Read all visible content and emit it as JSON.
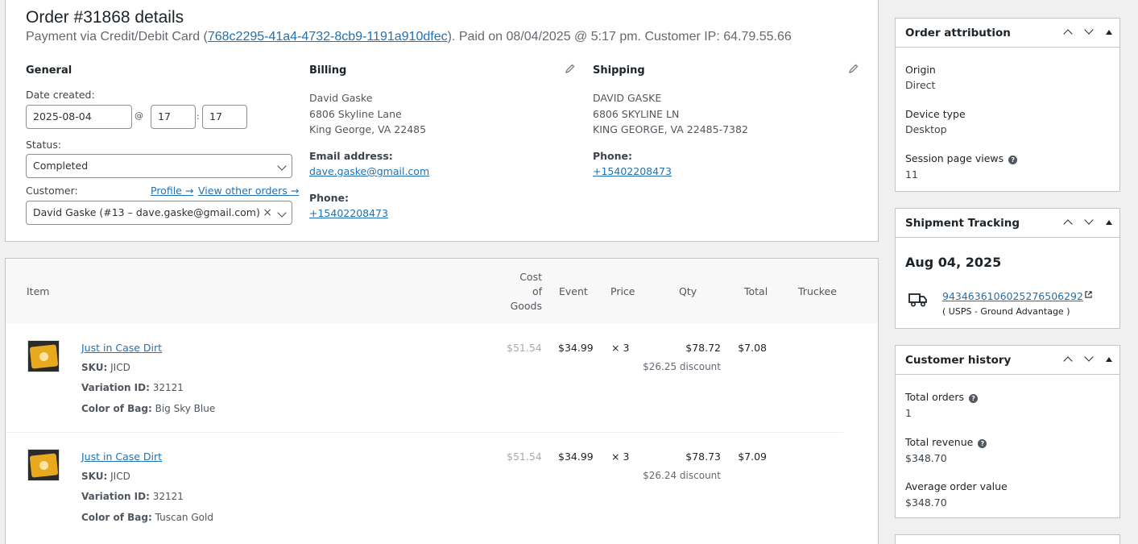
{
  "order": {
    "title": "Order #31868 details",
    "payment_prefix": "Payment via Credit/Debit Card (",
    "transaction_id": "768c2295-41a4-4732-8cb9-1191a910dfec",
    "payment_suffix": "). Paid on 08/04/2025 @ 5:17 pm. Customer IP: 64.79.55.66"
  },
  "general": {
    "heading": "General",
    "date_label": "Date created:",
    "date": "2025-08-04",
    "at": "@",
    "hour": "17",
    "colon": ":",
    "minute": "17",
    "status_label": "Status:",
    "status": "Completed",
    "customer_label": "Customer:",
    "profile_link": "Profile →",
    "other_orders_link": "View other orders →",
    "customer": "David Gaske (#13 – dave.gaske@gmail.com)",
    "clear": "×"
  },
  "billing": {
    "heading": "Billing",
    "name": "David Gaske",
    "street": "6806 Skyline Lane",
    "city": "King George, VA 22485",
    "email_label": "Email address:",
    "email": "dave.gaske@gmail.com",
    "phone_label": "Phone:",
    "phone": "+15402208473"
  },
  "shipping": {
    "heading": "Shipping",
    "name": "DAVID GASKE",
    "street": "6806 SKYLINE LN",
    "city": "KING GEORGE, VA 22485-7382",
    "phone_label": "Phone:",
    "phone": "+15402208473"
  },
  "items": {
    "columns": {
      "item": "Item",
      "cost_1": "Cost",
      "cost_2": "of",
      "cost_3": "Goods",
      "event": "Event",
      "price": "Price",
      "qty": "Qty",
      "total": "Total",
      "truckee": "Truckee"
    },
    "rows": [
      {
        "name": "Just in Case Dirt",
        "sku_label": "SKU:",
        "sku": "JICD",
        "variation_label": "Variation ID:",
        "variation": "32121",
        "color_label": "Color of Bag:",
        "color": "Big Sky Blue",
        "cost": "$51.54",
        "event": "$34.99",
        "qty": "× 3",
        "price_total": "$78.72",
        "discount": "$26.25 discount",
        "total": "$7.08"
      },
      {
        "name": "Just in Case Dirt",
        "sku_label": "SKU:",
        "sku": "JICD",
        "variation_label": "Variation ID:",
        "variation": "32121",
        "color_label": "Color of Bag:",
        "color": "Tuscan Gold",
        "cost": "$51.54",
        "event": "$34.99",
        "qty": "× 3",
        "price_total": "$78.73",
        "discount": "$26.24 discount",
        "total": "$7.09"
      }
    ]
  },
  "attribution": {
    "title": "Order attribution",
    "origin_label": "Origin",
    "origin": "Direct",
    "device_label": "Device type",
    "device": "Desktop",
    "views_label": "Session page views",
    "views": "11",
    "help": "?"
  },
  "tracking": {
    "title": "Shipment Tracking",
    "date": "Aug 04, 2025",
    "number": "9434636106025276506292",
    "carrier": "( USPS - Ground Advantage )"
  },
  "history": {
    "title": "Customer history",
    "orders_label": "Total orders",
    "orders": "1",
    "revenue_label": "Total revenue",
    "revenue": "$348.70",
    "aov_label": "Average order value",
    "aov": "$348.70",
    "help": "?"
  },
  "colors": {
    "link": "#2271b1",
    "border": "#c3c4c7",
    "text": "#1d2327"
  }
}
